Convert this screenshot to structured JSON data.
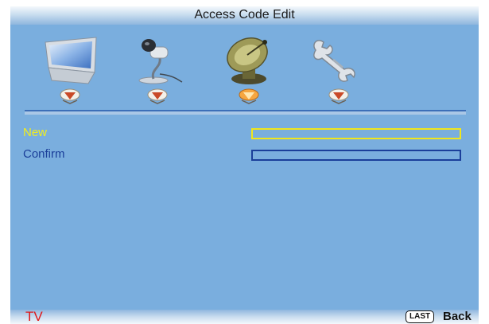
{
  "header": {
    "title": "Access Code Edit"
  },
  "menu_icons": [
    {
      "name": "picture-icon"
    },
    {
      "name": "sound-icon"
    },
    {
      "name": "channel-icon",
      "selected": true
    },
    {
      "name": "setup-icon"
    }
  ],
  "fields": {
    "new_label": "New",
    "new_value": "",
    "confirm_label": "Confirm",
    "confirm_value": ""
  },
  "footer": {
    "source": "TV",
    "key_label": "LAST",
    "key_action": "Back"
  },
  "colors": {
    "background": "#7aaede",
    "highlight": "#f2ee1c",
    "label": "#1b3f9a",
    "source": "#e01818"
  }
}
